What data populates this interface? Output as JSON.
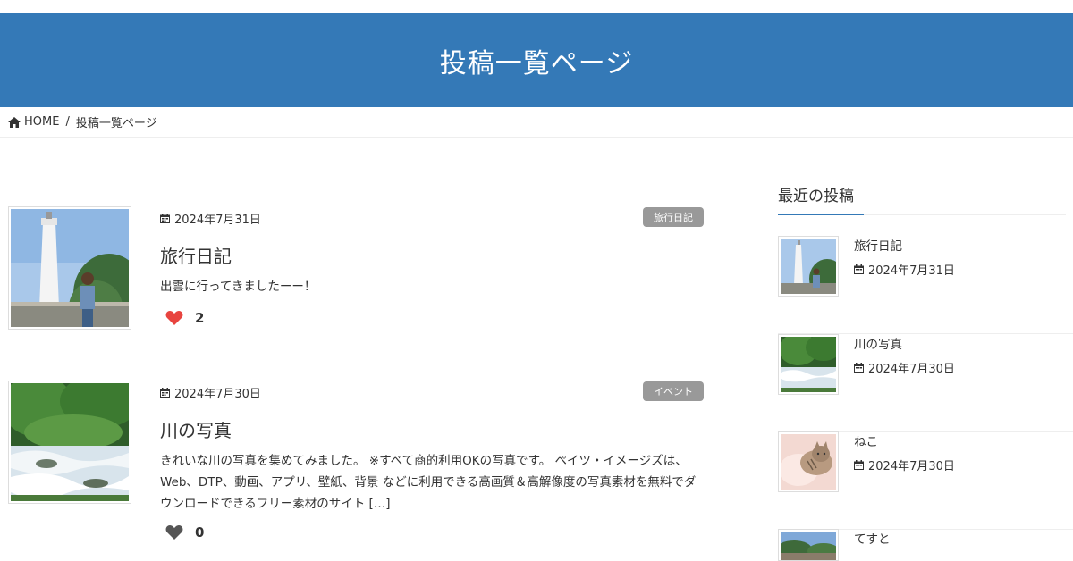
{
  "header": {
    "title": "投稿一覧ページ"
  },
  "breadcrumb": {
    "home_label": "HOME",
    "separator": "/",
    "current": "投稿一覧ページ"
  },
  "posts": [
    {
      "date": "2024年7月31日",
      "category": "旅行日記",
      "title": "旅行日記",
      "excerpt": "出雲に行ってきましたーー！",
      "likes": "2",
      "liked": true
    },
    {
      "date": "2024年7月30日",
      "category": "イベント",
      "title": "川の写真",
      "excerpt": "きれいな川の写真を集めてみました。 ※すべて商的利用OKの写真です。 ペイツ・イメージズは、Web、DTP、動画、アプリ、壁紙、背景 などに利用できる高画質＆高解像度の写真素材を無料でダウンロードできるフリー素材のサイト […]",
      "likes": "0",
      "liked": false
    }
  ],
  "sidebar": {
    "heading": "最近の投稿",
    "items": [
      {
        "title": "旅行日記",
        "date": "2024年7月31日"
      },
      {
        "title": "川の写真",
        "date": "2024年7月30日"
      },
      {
        "title": "ねこ",
        "date": "2024年7月30日"
      },
      {
        "title": "てすと",
        "date": ""
      }
    ]
  },
  "colors": {
    "header_bg": "#3479b7",
    "badge_bg": "#999999",
    "like_active": "#e8443f",
    "like_inactive": "#555555"
  }
}
